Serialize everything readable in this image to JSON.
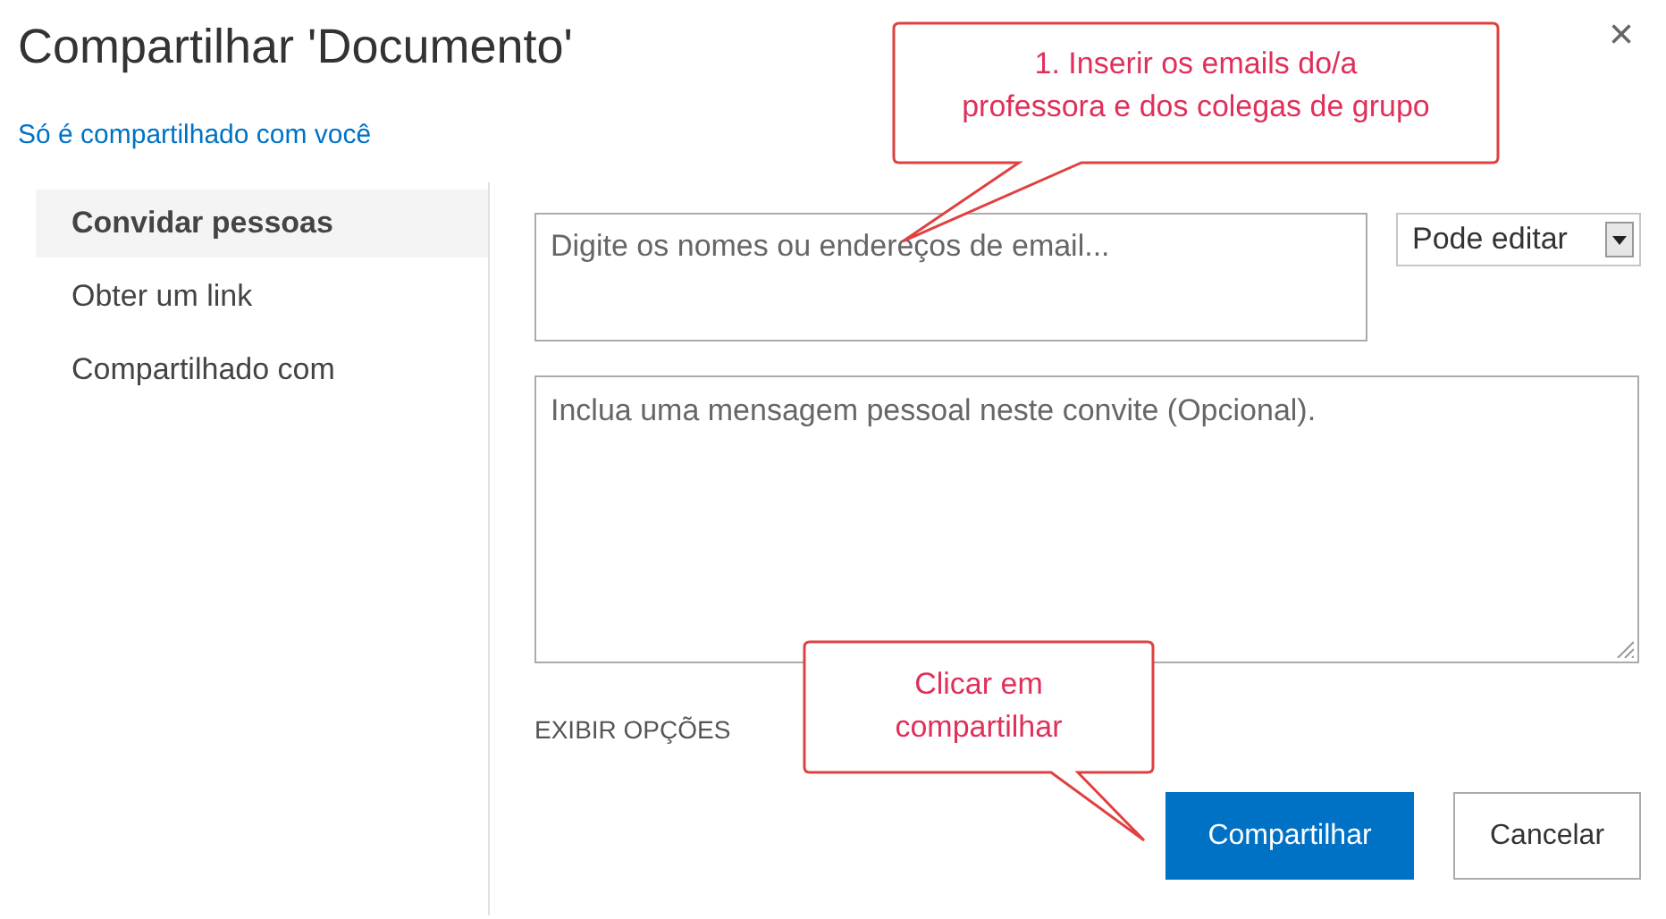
{
  "dialog": {
    "title": "Compartilhar 'Documento'",
    "close": "×",
    "sharing_status": "Só é compartilhado com você"
  },
  "sidebar": {
    "items": [
      {
        "label": "Convidar pessoas",
        "selected": true
      },
      {
        "label": "Obter um link",
        "selected": false
      },
      {
        "label": "Compartilhado com",
        "selected": false
      }
    ]
  },
  "invite": {
    "people_field": {
      "placeholder": "Digite os nomes ou endereços de email..."
    },
    "permission": {
      "value": "Pode editar"
    },
    "message_field": {
      "placeholder": "Inclua uma mensagem pessoal neste convite (Opcional)."
    },
    "options_link": "EXIBIR OPÇÕES",
    "buttons": [
      {
        "label": "Compartilhar",
        "kind": "primary"
      },
      {
        "label": "Cancelar",
        "kind": "secondary"
      }
    ]
  },
  "annotations": [
    {
      "lines": [
        "1. Inserir os emails do/a",
        "professora e dos colegas de grupo"
      ]
    },
    {
      "lines": [
        "Clicar em",
        "compartilhar"
      ]
    }
  ]
}
